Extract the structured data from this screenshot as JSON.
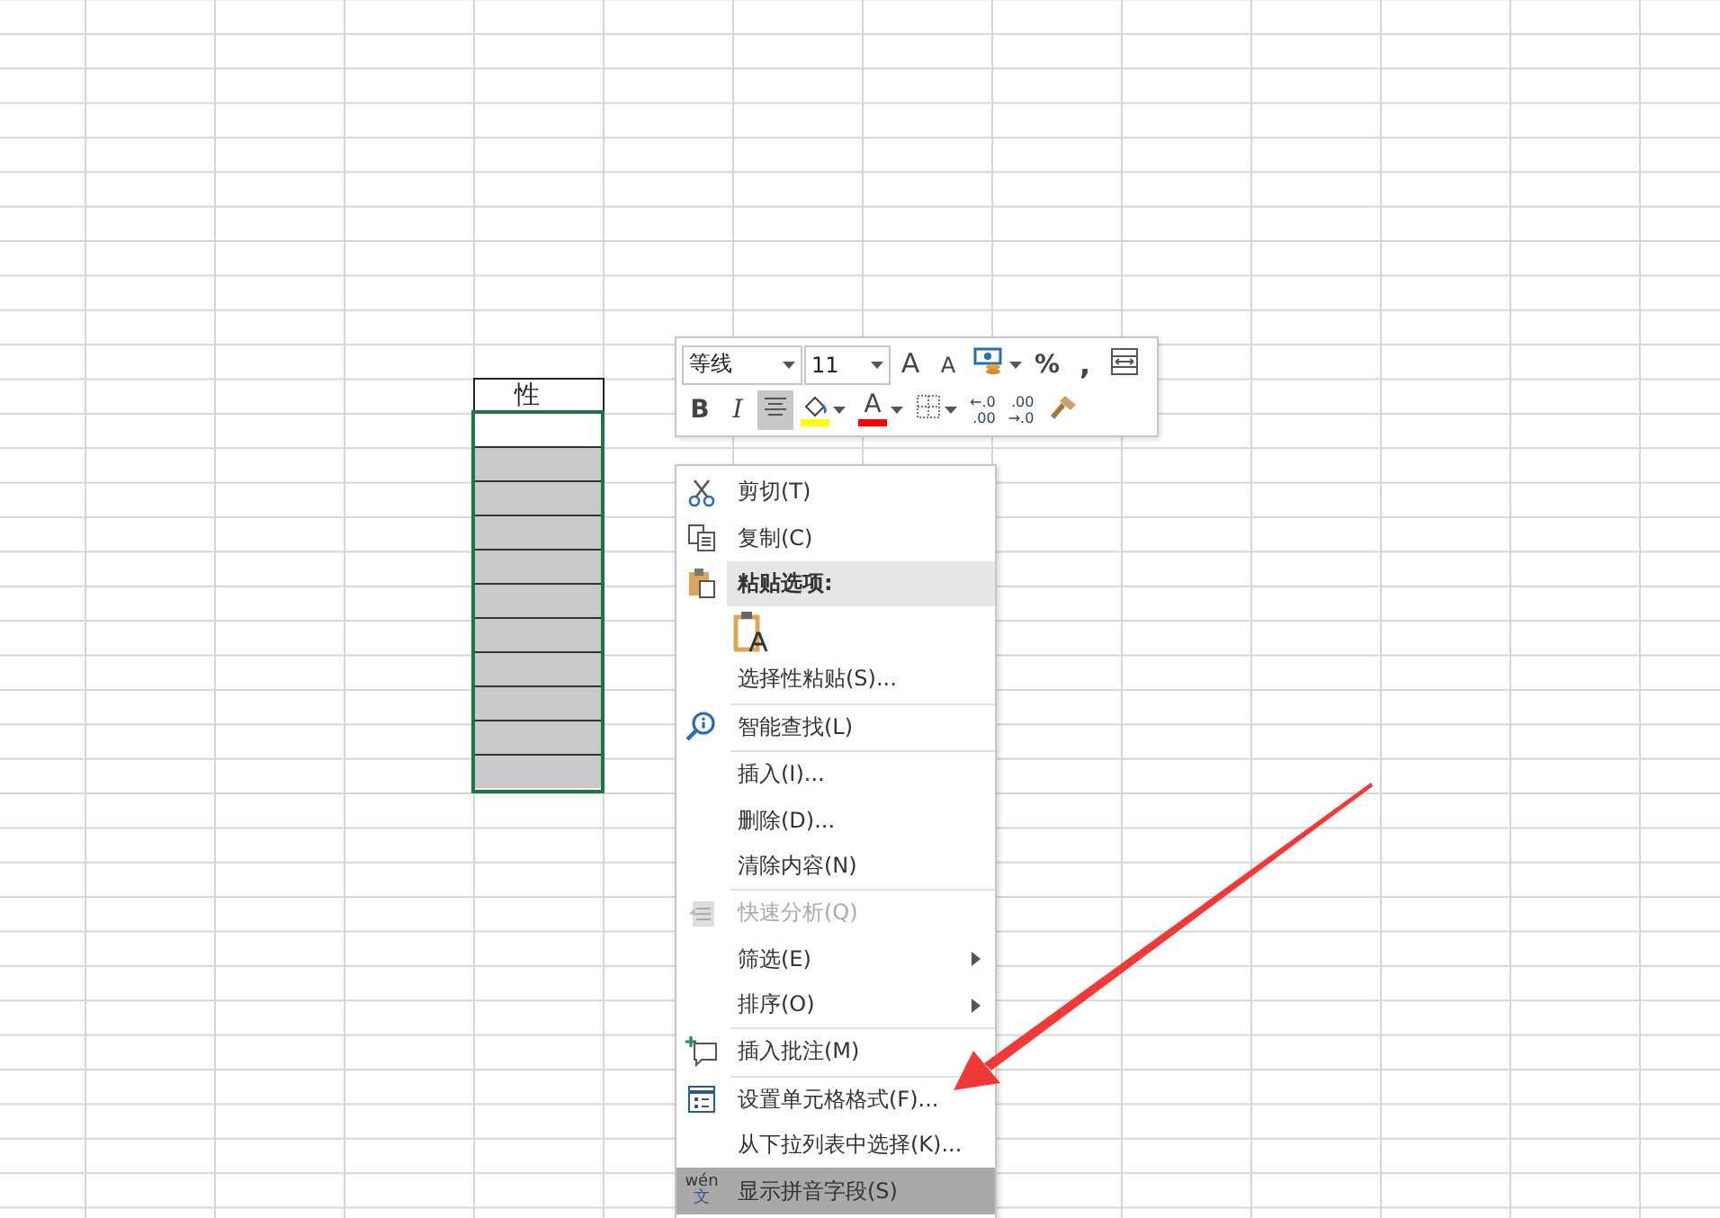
{
  "sheet": {
    "header_cell": "性"
  },
  "mini_toolbar": {
    "font": {
      "value": "等线"
    },
    "size": {
      "value": "11"
    },
    "rows": [
      [
        {
          "kind": "grow_font",
          "text": "A",
          "dropdown": false
        },
        {
          "kind": "shrink_font",
          "text": "A",
          "dropdown": false
        },
        {
          "kind": "number_format",
          "dropdown": true
        },
        {
          "kind": "percent",
          "text": "%",
          "dropdown": false
        },
        {
          "kind": "comma",
          "text": ",",
          "dropdown": false
        },
        {
          "kind": "table_format",
          "dropdown": false
        }
      ],
      [
        {
          "kind": "bold",
          "text": "B",
          "selected": false,
          "dropdown": false
        },
        {
          "kind": "italic",
          "text": "I",
          "selected": false,
          "dropdown": false
        },
        {
          "kind": "align_center",
          "selected": true,
          "dropdown": false
        },
        {
          "kind": "fill_color",
          "color": "#ffff00",
          "selected": false,
          "dropdown": true
        },
        {
          "kind": "font_color",
          "text": "A",
          "color": "#ff0000",
          "selected": false,
          "dropdown": true
        },
        {
          "kind": "borders",
          "selected": false,
          "dropdown": true
        },
        {
          "kind": "decimals",
          "lines": [
            "←.0",
            ".00"
          ],
          "selected": false,
          "dropdown": false
        },
        {
          "kind": "decimals",
          "lines": [
            ".00",
            "→.0"
          ],
          "selected": false,
          "dropdown": false
        },
        {
          "kind": "format_painter",
          "selected": false,
          "dropdown": false
        }
      ]
    ]
  },
  "context_menu": {
    "items": [
      {
        "kind": "item",
        "label": "剪切(T)",
        "disabled": false,
        "submenu": false,
        "highlighted": false
      },
      {
        "kind": "item",
        "label": "复制(C)",
        "disabled": false,
        "submenu": false,
        "highlighted": false
      },
      {
        "kind": "header",
        "label": "粘贴选项:"
      },
      {
        "kind": "paste_options"
      },
      {
        "kind": "item",
        "label": "选择性粘贴(S)...",
        "disabled": false,
        "submenu": false,
        "highlighted": false
      },
      {
        "kind": "separator"
      },
      {
        "kind": "item",
        "label": "智能查找(L)",
        "disabled": false,
        "submenu": false,
        "highlighted": false
      },
      {
        "kind": "separator"
      },
      {
        "kind": "item",
        "label": "插入(I)...",
        "disabled": false,
        "submenu": false,
        "highlighted": false
      },
      {
        "kind": "item",
        "label": "删除(D)...",
        "disabled": false,
        "submenu": false,
        "highlighted": false
      },
      {
        "kind": "item",
        "label": "清除内容(N)",
        "disabled": false,
        "submenu": false,
        "highlighted": false
      },
      {
        "kind": "separator"
      },
      {
        "kind": "item",
        "label": "快速分析(Q)",
        "disabled": true,
        "submenu": false,
        "highlighted": false
      },
      {
        "kind": "item",
        "label": "筛选(E)",
        "disabled": false,
        "submenu": true,
        "highlighted": false
      },
      {
        "kind": "item",
        "label": "排序(O)",
        "disabled": false,
        "submenu": true,
        "highlighted": false
      },
      {
        "kind": "separator"
      },
      {
        "kind": "item",
        "label": "插入批注(M)",
        "disabled": false,
        "submenu": false,
        "highlighted": false
      },
      {
        "kind": "separator"
      },
      {
        "kind": "item",
        "label": "设置单元格格式(F)...",
        "disabled": false,
        "submenu": false,
        "highlighted": false
      },
      {
        "kind": "item",
        "label": "从下拉列表中选择(K)...",
        "disabled": false,
        "submenu": false,
        "highlighted": false
      },
      {
        "kind": "item",
        "label": "显示拼音字段(S)",
        "disabled": false,
        "submenu": false,
        "highlighted": true,
        "icon_text": [
          "wén",
          "文"
        ]
      }
    ]
  }
}
